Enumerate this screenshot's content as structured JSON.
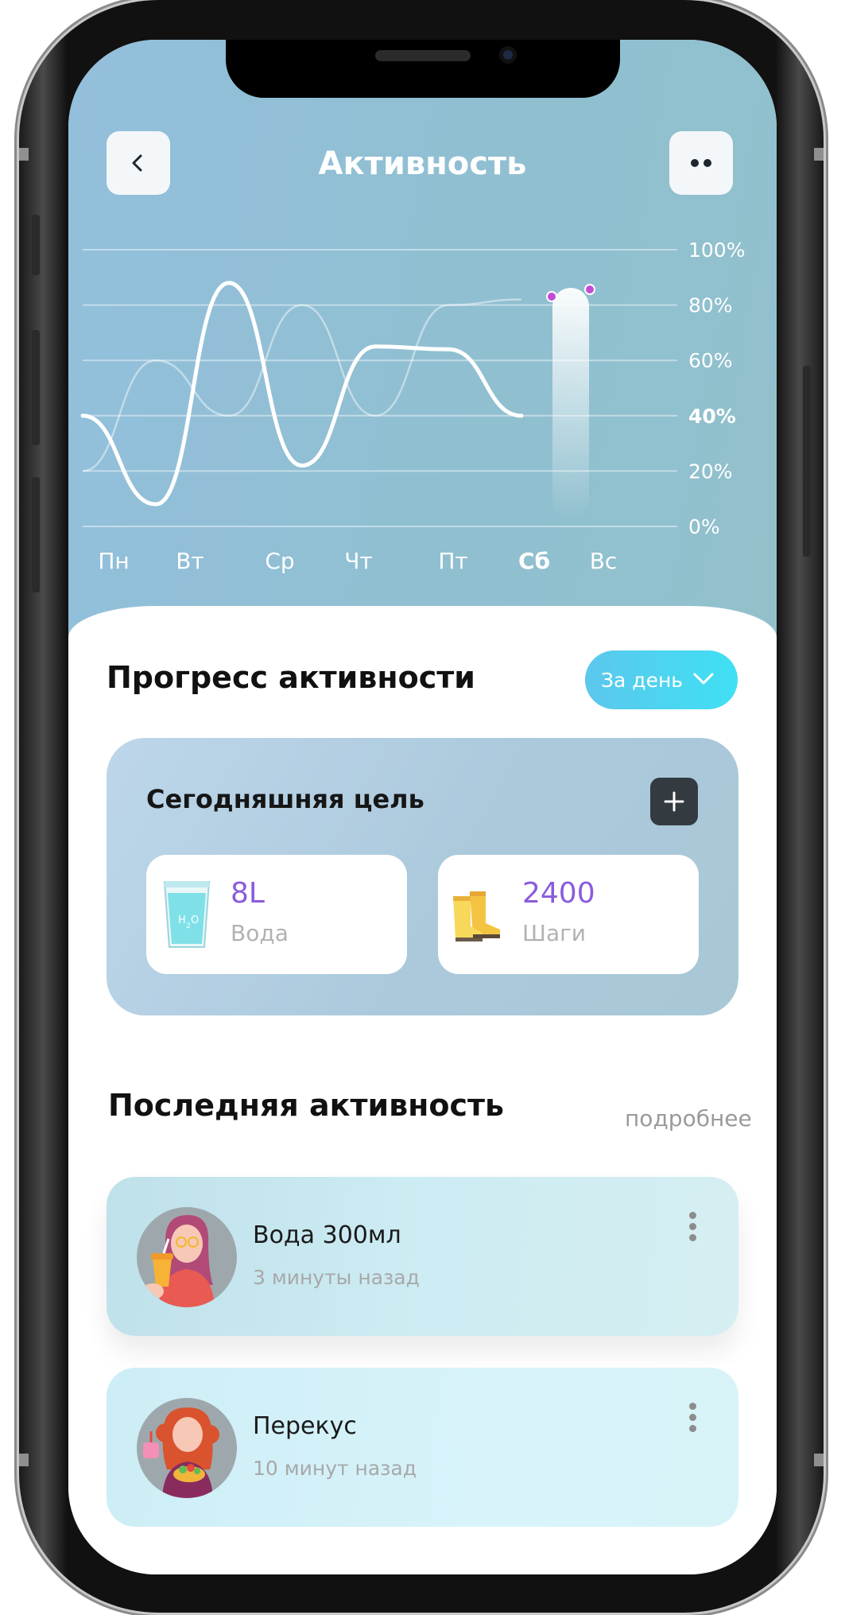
{
  "header": {
    "title": "Активность",
    "back_icon": "chevron-left-icon",
    "more_icon": "more-dots-icon"
  },
  "chart_data": {
    "type": "line",
    "x": [
      "Пн",
      "Вт",
      "Ср",
      "Чт",
      "Пт",
      "Сб",
      "Вс"
    ],
    "highlight": "Сб",
    "y_ticks": [
      "100%",
      "80%",
      "60%",
      "40%",
      "20%",
      "0%"
    ],
    "y_highlight": "40%",
    "ylim": [
      0,
      100
    ],
    "series": [
      {
        "values": [
          40,
          8,
          88,
          22,
          65,
          64,
          40
        ]
      },
      {
        "values": [
          20,
          60,
          40,
          80,
          40,
          80,
          82
        ]
      }
    ],
    "grid": true
  },
  "progress": {
    "title": "Прогресс активности",
    "period_label": "За день"
  },
  "goal": {
    "title": "Сегодняшняя цель",
    "add_icon": "plus-icon",
    "water": {
      "value": "8L",
      "label": "Вода",
      "icon": "water-glass-icon"
    },
    "steps": {
      "value": "2400",
      "label": "Шаги",
      "icon": "boots-icon"
    }
  },
  "recent": {
    "title": "Последняя активность",
    "more_link": "подробнее",
    "items": [
      {
        "name_prefix": "Вода ",
        "name_amount": "300",
        "name_unit": "мл",
        "time": "3 минуты назад"
      },
      {
        "name": "Перекус",
        "time": "10 минут назад"
      }
    ]
  },
  "colors": {
    "accent_purple": "#8a5bdc",
    "cyan_button": "#4fd2f0",
    "dark_button": "#333a40"
  }
}
